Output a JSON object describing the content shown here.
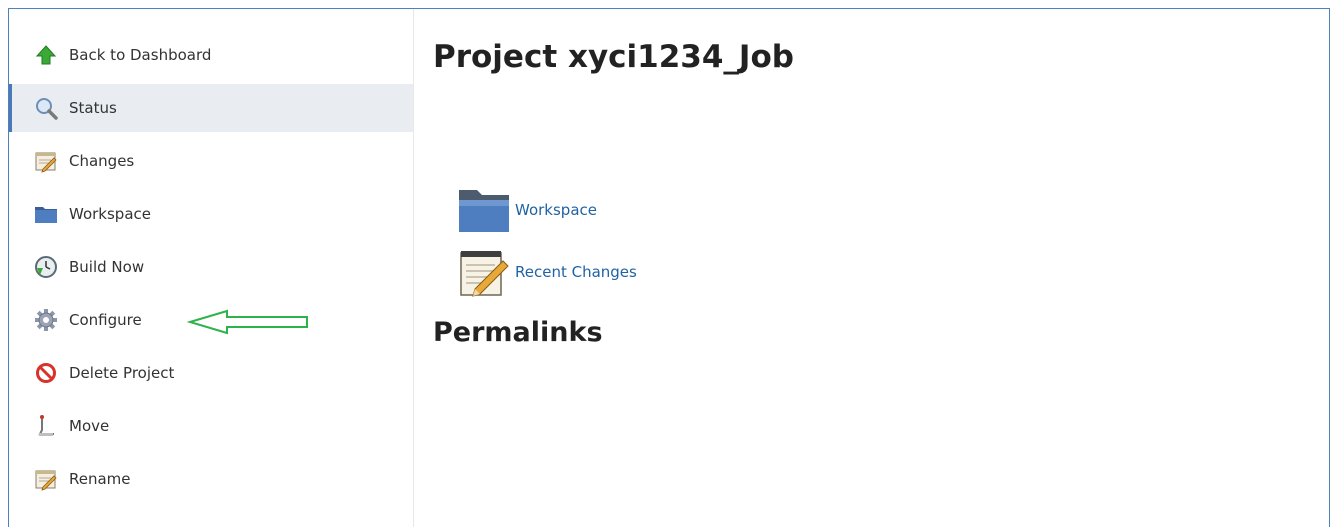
{
  "sidebar": {
    "items": [
      {
        "label": "Back to Dashboard",
        "icon": "up-arrow-icon"
      },
      {
        "label": "Status",
        "icon": "magnifier-icon"
      },
      {
        "label": "Changes",
        "icon": "notepad-icon"
      },
      {
        "label": "Workspace",
        "icon": "folder-icon"
      },
      {
        "label": "Build Now",
        "icon": "clock-play-icon"
      },
      {
        "label": "Configure",
        "icon": "gear-icon"
      },
      {
        "label": "Delete Project",
        "icon": "no-entry-icon"
      },
      {
        "label": "Move",
        "icon": "move-icon"
      },
      {
        "label": "Rename",
        "icon": "notepad-icon"
      }
    ],
    "active_index": 1
  },
  "main": {
    "title": "Project xyci1234_Job",
    "links": [
      {
        "label": "Workspace",
        "icon": "folder-icon"
      },
      {
        "label": "Recent Changes",
        "icon": "notepad-icon"
      }
    ],
    "permalinks_heading": "Permalinks"
  },
  "colors": {
    "link": "#1f63a5",
    "active_bg": "#e9edf2",
    "active_border": "#4a79b5",
    "annotation_arrow": "#2eb34a",
    "frame_border": "#4f81bd"
  }
}
